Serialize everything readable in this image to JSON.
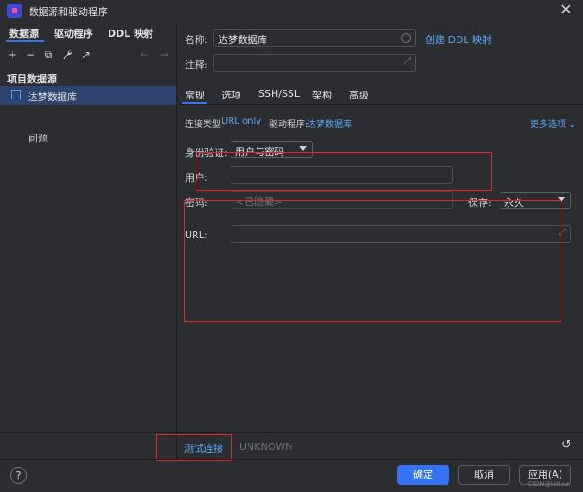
{
  "window": {
    "title": "数据源和驱动程序"
  },
  "left": {
    "tabs": [
      "数据源",
      "驱动程序",
      "DDL 映射"
    ],
    "toolbar": {
      "add": "+",
      "remove": "−",
      "copy": "⧉",
      "wrench": "🔧",
      "export": "↗",
      "back": "←",
      "forward": "→"
    },
    "section_header": "项目数据源",
    "datasource_item": "达梦数据库",
    "problems": "问题"
  },
  "right": {
    "name_label": "名称:",
    "name_value": "达梦数据库",
    "create_ddl_link": "创建 DDL 映射",
    "comment_label": "注释:",
    "tabs": [
      "常规",
      "选项",
      "SSH/SSL",
      "架构",
      "高级"
    ],
    "conn_type_label": "连接类型:",
    "conn_type_value": "URL only",
    "driver_label": "驱动程序:",
    "driver_value": "达梦数据库",
    "more_options": "更多选项",
    "auth_label": "身份验证:",
    "auth_value": "用户与密码",
    "user_label": "用户:",
    "password_label": "密码:",
    "password_placeholder": "<已隐藏>",
    "save_label": "保存:",
    "save_value": "永久",
    "url_label": "URL:"
  },
  "bottom": {
    "test_connection": "测试连接",
    "status": "UNKNOWN",
    "ok": "确定",
    "cancel": "取消",
    "apply": "应用(A)",
    "help": "?",
    "watermark": "CSDN @kz0yun"
  },
  "colors": {
    "accent": "#3574f0",
    "link": "#56a8f5",
    "annotation": "#e5232b",
    "selection": "#2e436e"
  }
}
